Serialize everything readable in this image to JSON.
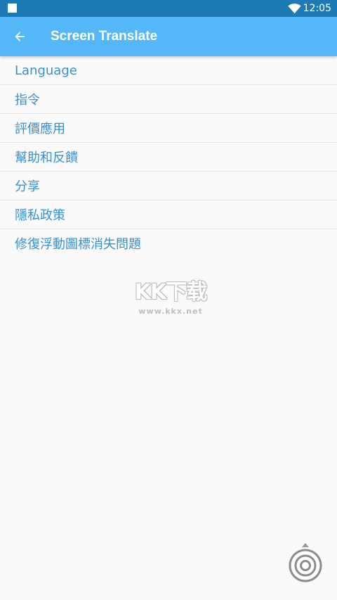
{
  "status_bar": {
    "time": "12:05",
    "icons": [
      "notification-square-icon",
      "wifi-icon"
    ]
  },
  "app_bar": {
    "back_icon": "arrow-left-icon",
    "title": "Screen Translate"
  },
  "menu": {
    "items": [
      {
        "label": "Language"
      },
      {
        "label": "指令"
      },
      {
        "label": "評價應用"
      },
      {
        "label": "幫助和反饋"
      },
      {
        "label": "分享"
      },
      {
        "label": "隱私政策"
      },
      {
        "label": "修復浮動圖標消失問題"
      }
    ]
  },
  "watermark": {
    "logo": "KK下载",
    "url": "www.kkx.net"
  },
  "floating_button": {
    "icon": "target-icon"
  },
  "colors": {
    "status_bar": "#1e7ab5",
    "app_bar": "#55b7f8",
    "menu_text": "#3b8fd0",
    "background": "#fafafa",
    "divider": "#e6e6e6"
  }
}
